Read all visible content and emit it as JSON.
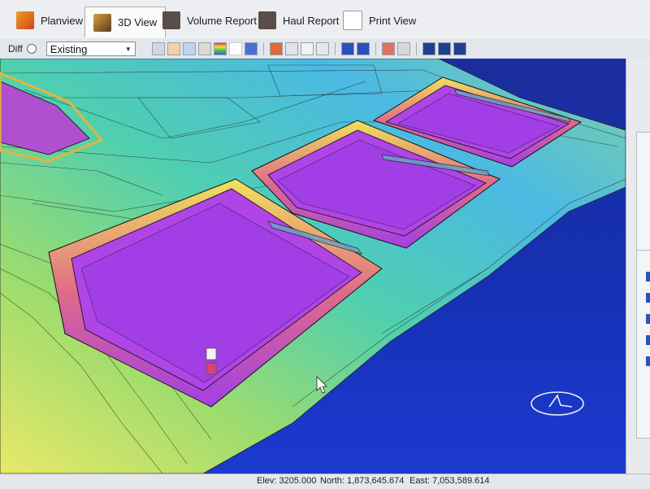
{
  "tabs": [
    {
      "label": "Planview",
      "active": false
    },
    {
      "label": "3D View",
      "active": true
    },
    {
      "label": "Volume Report",
      "active": false
    },
    {
      "label": "Haul Report",
      "active": false
    },
    {
      "label": "Print View",
      "active": false
    }
  ],
  "toolbar": {
    "diff_label": "Diff",
    "surface_select_value": "Existing",
    "icons": [
      "home-icon",
      "pan-hand-icon",
      "zoom-icon",
      "layers-icon",
      "color-scale-icon",
      "triangle-icon",
      "water-drop-icon",
      "red-circle-icon",
      "tool-icon",
      "page-icon",
      "sheet-icon",
      "a-icon",
      "v-icon",
      "home-alt-icon",
      "image-icon",
      "grid-icon",
      "magnet-icon",
      "sv-icon"
    ]
  },
  "status": {
    "elev": "Elev: 3205.000",
    "north": "North: 1,873,645.674",
    "east": "East: 7,053,589.614"
  },
  "colors": {
    "pond": "#a23ee6",
    "terrain_low": "#2bbfe0",
    "terrain_mid": "#7ed37a",
    "terrain_high": "#f0e24a",
    "background": "#1b36c4"
  }
}
